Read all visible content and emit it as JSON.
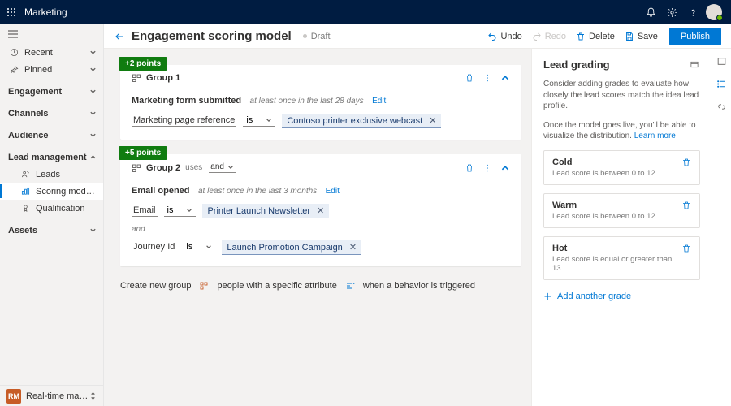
{
  "topbar": {
    "app_name": "Marketing"
  },
  "nav": {
    "recent": "Recent",
    "pinned": "Pinned",
    "sections": {
      "engagement": "Engagement",
      "channels": "Channels",
      "audience": "Audience",
      "lead_management": "Lead management",
      "assets": "Assets"
    },
    "lead_items": {
      "leads": "Leads",
      "scoring_models": "Scoring models",
      "qualification": "Qualification"
    },
    "footer": {
      "badge": "RM",
      "label": "Real-time marketi…"
    }
  },
  "cmdbar": {
    "title": "Engagement scoring model",
    "status": "Draft",
    "undo": "Undo",
    "redo": "Redo",
    "delete": "Delete",
    "save": "Save",
    "publish": "Publish"
  },
  "groups": [
    {
      "points": "+2 points",
      "title": "Group 1",
      "rule_title": "Marketing form submitted",
      "rule_sub": "at least once in the last 28 days",
      "edit": "Edit",
      "cond_field": "Marketing page reference",
      "cond_op": "is",
      "cond_value": "Contoso printer exclusive webcast"
    },
    {
      "points": "+5 points",
      "title": "Group 2",
      "uses": "uses",
      "combine_op": "and",
      "rule_title": "Email opened",
      "rule_sub": "at least once in the last 3 months",
      "edit": "Edit",
      "cond1_field": "Email",
      "cond1_op": "is",
      "cond1_value": "Printer Launch Newsletter",
      "and": "and",
      "cond2_field": "Journey Id",
      "cond2_op": "is",
      "cond2_value": "Launch Promotion Campaign"
    }
  ],
  "create": {
    "label": "Create new group",
    "attr": "people with a specific attribute",
    "behavior": "when a behavior is triggered"
  },
  "side": {
    "title": "Lead grading",
    "hint1": "Consider adding grades to evaluate how closely the lead scores match the idea lead profile.",
    "hint2_a": "Once the model goes live, you'll be able to visualize the distribution. ",
    "hint2_link": "Learn more",
    "grades": [
      {
        "title": "Cold",
        "sub": "Lead score is between 0 to 12"
      },
      {
        "title": "Warm",
        "sub": "Lead score is between 0 to 12"
      },
      {
        "title": "Hot",
        "sub": "Lead score is equal or greater than 13"
      }
    ],
    "add": "Add another grade"
  }
}
